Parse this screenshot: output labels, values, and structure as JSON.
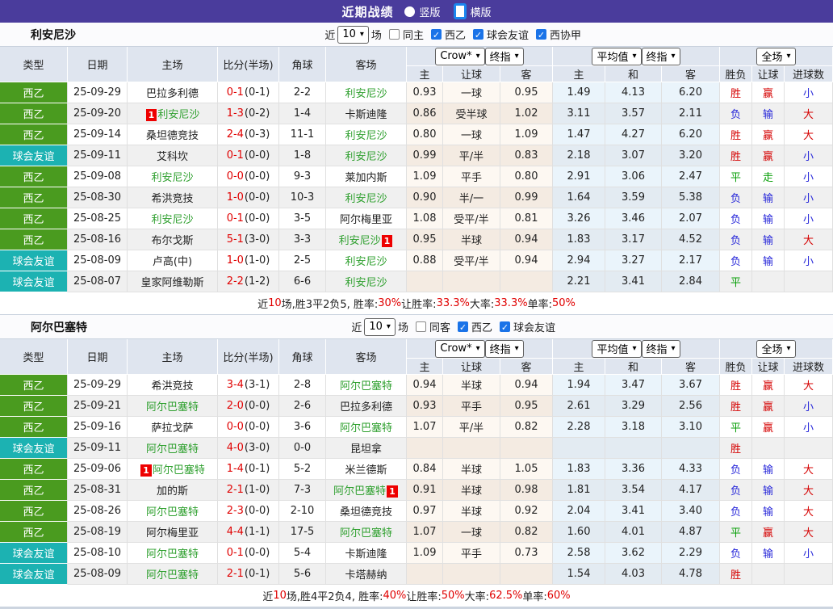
{
  "title_bar": {
    "title": "近期战绩",
    "radio_vertical": "竖版",
    "radio_horizontal": "横版",
    "selected": "横版",
    "bar_color": "#4a3c9c"
  },
  "colors": {
    "league_西乙": "#4a9b1f",
    "league_球会友谊": "#1cb2b2",
    "league_西协甲": "#4a9b1f",
    "focus_team_green": "#2fa02f",
    "score_red": "#e00000",
    "win_red": "#d50000",
    "lose_blue": "#2626d9",
    "draw_green": "#089f08",
    "checkbox_blue": "#1a73e8"
  },
  "columns": {
    "type": "类型",
    "date": "日期",
    "home": "主场",
    "score": "比分(半场)",
    "corner": "角球",
    "away": "客场",
    "group_crow_select": "Crow*",
    "group_final_select_1": "终指",
    "group_avg_select": "平均值",
    "group_final_select_2": "终指",
    "group_full_select": "全场",
    "sub": [
      "主",
      "让球",
      "客",
      "主",
      "和",
      "客",
      "胜负",
      "让球",
      "进球数"
    ]
  },
  "tables": [
    {
      "team": "利安尼沙",
      "filter": {
        "prefix": "近",
        "matches_select": "10",
        "suffix": "场",
        "same_label": "同主",
        "same_checked": false,
        "leagues": [
          {
            "label": "西乙",
            "checked": true
          },
          {
            "label": "球会友谊",
            "checked": true
          },
          {
            "label": "西协甲",
            "checked": true
          }
        ]
      },
      "rows": [
        {
          "league": "西乙",
          "date": "25-09-29",
          "home": "巴拉多利德",
          "home_team": false,
          "home_badge": null,
          "score": "0-1",
          "half": "(0-1)",
          "corner": "2-2",
          "away": "利安尼沙",
          "away_team": true,
          "away_badge": null,
          "crow": [
            "0.93",
            "一球",
            "0.95"
          ],
          "avg": [
            "1.49",
            "4.13",
            "6.20"
          ],
          "res": [
            "胜",
            "赢",
            "小"
          ]
        },
        {
          "league": "西乙",
          "date": "25-09-20",
          "home": "利安尼沙",
          "home_team": true,
          "home_badge": "before",
          "score": "1-3",
          "half": "(0-2)",
          "corner": "1-4",
          "away": "卡斯迪隆",
          "away_team": false,
          "away_badge": null,
          "crow": [
            "0.86",
            "受半球",
            "1.02"
          ],
          "avg": [
            "3.11",
            "3.57",
            "2.11"
          ],
          "res": [
            "负",
            "输",
            "大"
          ]
        },
        {
          "league": "西乙",
          "date": "25-09-14",
          "home": "桑坦德竞技",
          "home_team": false,
          "home_badge": null,
          "score": "2-4",
          "half": "(0-3)",
          "corner": "11-1",
          "away": "利安尼沙",
          "away_team": true,
          "away_badge": null,
          "crow": [
            "0.80",
            "一球",
            "1.09"
          ],
          "avg": [
            "1.47",
            "4.27",
            "6.20"
          ],
          "res": [
            "胜",
            "赢",
            "大"
          ]
        },
        {
          "league": "球会友谊",
          "date": "25-09-11",
          "home": "艾科坎",
          "home_team": false,
          "home_badge": null,
          "score": "0-1",
          "half": "(0-0)",
          "corner": "1-8",
          "away": "利安尼沙",
          "away_team": true,
          "away_badge": null,
          "crow": [
            "0.99",
            "平/半",
            "0.83"
          ],
          "avg": [
            "2.18",
            "3.07",
            "3.20"
          ],
          "res": [
            "胜",
            "赢",
            "小"
          ]
        },
        {
          "league": "西乙",
          "date": "25-09-08",
          "home": "利安尼沙",
          "home_team": true,
          "home_badge": null,
          "score": "0-0",
          "half": "(0-0)",
          "corner": "9-3",
          "away": "莱加内斯",
          "away_team": false,
          "away_badge": null,
          "crow": [
            "1.09",
            "平手",
            "0.80"
          ],
          "avg": [
            "2.91",
            "3.06",
            "2.47"
          ],
          "res": [
            "平",
            "走",
            "小"
          ]
        },
        {
          "league": "西乙",
          "date": "25-08-30",
          "home": "希洪竞技",
          "home_team": false,
          "home_badge": null,
          "score": "1-0",
          "half": "(0-0)",
          "corner": "10-3",
          "away": "利安尼沙",
          "away_team": true,
          "away_badge": null,
          "crow": [
            "0.90",
            "半/一",
            "0.99"
          ],
          "avg": [
            "1.64",
            "3.59",
            "5.38"
          ],
          "res": [
            "负",
            "输",
            "小"
          ]
        },
        {
          "league": "西乙",
          "date": "25-08-25",
          "home": "利安尼沙",
          "home_team": true,
          "home_badge": null,
          "score": "0-1",
          "half": "(0-0)",
          "corner": "3-5",
          "away": "阿尔梅里亚",
          "away_team": false,
          "away_badge": null,
          "crow": [
            "1.08",
            "受平/半",
            "0.81"
          ],
          "avg": [
            "3.26",
            "3.46",
            "2.07"
          ],
          "res": [
            "负",
            "输",
            "小"
          ]
        },
        {
          "league": "西乙",
          "date": "25-08-16",
          "home": "布尔戈斯",
          "home_team": false,
          "home_badge": null,
          "score": "5-1",
          "half": "(3-0)",
          "corner": "3-3",
          "away": "利安尼沙",
          "away_team": true,
          "away_badge": "after",
          "crow": [
            "0.95",
            "半球",
            "0.94"
          ],
          "avg": [
            "1.83",
            "3.17",
            "4.52"
          ],
          "res": [
            "负",
            "输",
            "大"
          ]
        },
        {
          "league": "球会友谊",
          "date": "25-08-09",
          "home": "卢高(中)",
          "home_team": false,
          "home_badge": null,
          "score": "1-0",
          "half": "(1-0)",
          "corner": "2-5",
          "away": "利安尼沙",
          "away_team": true,
          "away_badge": null,
          "crow": [
            "0.88",
            "受平/半",
            "0.94"
          ],
          "avg": [
            "2.94",
            "3.27",
            "2.17"
          ],
          "res": [
            "负",
            "输",
            "小"
          ]
        },
        {
          "league": "球会友谊",
          "date": "25-08-07",
          "home": "皇家阿维勒斯",
          "home_team": false,
          "home_badge": null,
          "score": "2-2",
          "half": "(1-2)",
          "corner": "6-6",
          "away": "利安尼沙",
          "away_team": true,
          "away_badge": null,
          "crow": [
            "",
            "",
            ""
          ],
          "avg": [
            "2.21",
            "3.41",
            "2.84"
          ],
          "res": [
            "平",
            "",
            ""
          ]
        }
      ],
      "summary": [
        {
          "t": "近"
        },
        {
          "t": "10",
          "r": 1
        },
        {
          "t": "场,胜3平2负5, 胜率:"
        },
        {
          "t": "30%",
          "r": 1
        },
        {
          "t": " 让胜率:"
        },
        {
          "t": "33.3%",
          "r": 1
        },
        {
          "t": " 大率:"
        },
        {
          "t": "33.3%",
          "r": 1
        },
        {
          "t": " 单率:"
        },
        {
          "t": "50%",
          "r": 1
        }
      ]
    },
    {
      "team": "阿尔巴塞特",
      "filter": {
        "prefix": "近",
        "matches_select": "10",
        "suffix": "场",
        "same_label": "同客",
        "same_checked": false,
        "leagues": [
          {
            "label": "西乙",
            "checked": true
          },
          {
            "label": "球会友谊",
            "checked": true
          }
        ]
      },
      "rows": [
        {
          "league": "西乙",
          "date": "25-09-29",
          "home": "希洪竞技",
          "home_team": false,
          "home_badge": null,
          "score": "3-4",
          "half": "(3-1)",
          "corner": "2-8",
          "away": "阿尔巴塞特",
          "away_team": true,
          "away_badge": null,
          "crow": [
            "0.94",
            "半球",
            "0.94"
          ],
          "avg": [
            "1.94",
            "3.47",
            "3.67"
          ],
          "res": [
            "胜",
            "赢",
            "大"
          ]
        },
        {
          "league": "西乙",
          "date": "25-09-21",
          "home": "阿尔巴塞特",
          "home_team": true,
          "home_badge": null,
          "score": "2-0",
          "half": "(0-0)",
          "corner": "2-6",
          "away": "巴拉多利德",
          "away_team": false,
          "away_badge": null,
          "crow": [
            "0.93",
            "平手",
            "0.95"
          ],
          "avg": [
            "2.61",
            "3.29",
            "2.56"
          ],
          "res": [
            "胜",
            "赢",
            "小"
          ]
        },
        {
          "league": "西乙",
          "date": "25-09-16",
          "home": "萨拉戈萨",
          "home_team": false,
          "home_badge": null,
          "score": "0-0",
          "half": "(0-0)",
          "corner": "3-6",
          "away": "阿尔巴塞特",
          "away_team": true,
          "away_badge": null,
          "crow": [
            "1.07",
            "平/半",
            "0.82"
          ],
          "avg": [
            "2.28",
            "3.18",
            "3.10"
          ],
          "res": [
            "平",
            "赢",
            "小"
          ]
        },
        {
          "league": "球会友谊",
          "date": "25-09-11",
          "home": "阿尔巴塞特",
          "home_team": true,
          "home_badge": null,
          "score": "4-0",
          "half": "(3-0)",
          "corner": "0-0",
          "away": "昆坦拿",
          "away_team": false,
          "away_badge": null,
          "crow": [
            "",
            "",
            ""
          ],
          "avg": [
            "",
            "",
            ""
          ],
          "res": [
            "胜",
            "",
            ""
          ]
        },
        {
          "league": "西乙",
          "date": "25-09-06",
          "home": "阿尔巴塞特",
          "home_team": true,
          "home_badge": "before",
          "score": "1-4",
          "half": "(0-1)",
          "corner": "5-2",
          "away": "米兰德斯",
          "away_team": false,
          "away_badge": null,
          "crow": [
            "0.84",
            "半球",
            "1.05"
          ],
          "avg": [
            "1.83",
            "3.36",
            "4.33"
          ],
          "res": [
            "负",
            "输",
            "大"
          ]
        },
        {
          "league": "西乙",
          "date": "25-08-31",
          "home": "加的斯",
          "home_team": false,
          "home_badge": null,
          "score": "2-1",
          "half": "(1-0)",
          "corner": "7-3",
          "away": "阿尔巴塞特",
          "away_team": true,
          "away_badge": "after",
          "crow": [
            "0.91",
            "半球",
            "0.98"
          ],
          "avg": [
            "1.81",
            "3.54",
            "4.17"
          ],
          "res": [
            "负",
            "输",
            "大"
          ]
        },
        {
          "league": "西乙",
          "date": "25-08-26",
          "home": "阿尔巴塞特",
          "home_team": true,
          "home_badge": null,
          "score": "2-3",
          "half": "(0-0)",
          "corner": "2-10",
          "away": "桑坦德竞技",
          "away_team": false,
          "away_badge": null,
          "crow": [
            "0.97",
            "半球",
            "0.92"
          ],
          "avg": [
            "2.04",
            "3.41",
            "3.40"
          ],
          "res": [
            "负",
            "输",
            "大"
          ]
        },
        {
          "league": "西乙",
          "date": "25-08-19",
          "home": "阿尔梅里亚",
          "home_team": false,
          "home_badge": null,
          "score": "4-4",
          "half": "(1-1)",
          "corner": "17-5",
          "away": "阿尔巴塞特",
          "away_team": true,
          "away_badge": null,
          "crow": [
            "1.07",
            "一球",
            "0.82"
          ],
          "avg": [
            "1.60",
            "4.01",
            "4.87"
          ],
          "res": [
            "平",
            "赢",
            "大"
          ]
        },
        {
          "league": "球会友谊",
          "date": "25-08-10",
          "home": "阿尔巴塞特",
          "home_team": true,
          "home_badge": null,
          "score": "0-1",
          "half": "(0-0)",
          "corner": "5-4",
          "away": "卡斯迪隆",
          "away_team": false,
          "away_badge": null,
          "crow": [
            "1.09",
            "平手",
            "0.73"
          ],
          "avg": [
            "2.58",
            "3.62",
            "2.29"
          ],
          "res": [
            "负",
            "输",
            "小"
          ]
        },
        {
          "league": "球会友谊",
          "date": "25-08-09",
          "home": "阿尔巴塞特",
          "home_team": true,
          "home_badge": null,
          "score": "2-1",
          "half": "(0-1)",
          "corner": "5-6",
          "away": "卡塔赫纳",
          "away_team": false,
          "away_badge": null,
          "crow": [
            "",
            "",
            ""
          ],
          "avg": [
            "1.54",
            "4.03",
            "4.78"
          ],
          "res": [
            "胜",
            "",
            ""
          ]
        }
      ],
      "summary": [
        {
          "t": "近"
        },
        {
          "t": "10",
          "r": 1
        },
        {
          "t": "场,胜4平2负4, 胜率:"
        },
        {
          "t": "40%",
          "r": 1
        },
        {
          "t": " 让胜率:"
        },
        {
          "t": "50%",
          "r": 1
        },
        {
          "t": " 大率:"
        },
        {
          "t": "62.5%",
          "r": 1
        },
        {
          "t": " 单率:"
        },
        {
          "t": "60%",
          "r": 1
        }
      ]
    }
  ]
}
